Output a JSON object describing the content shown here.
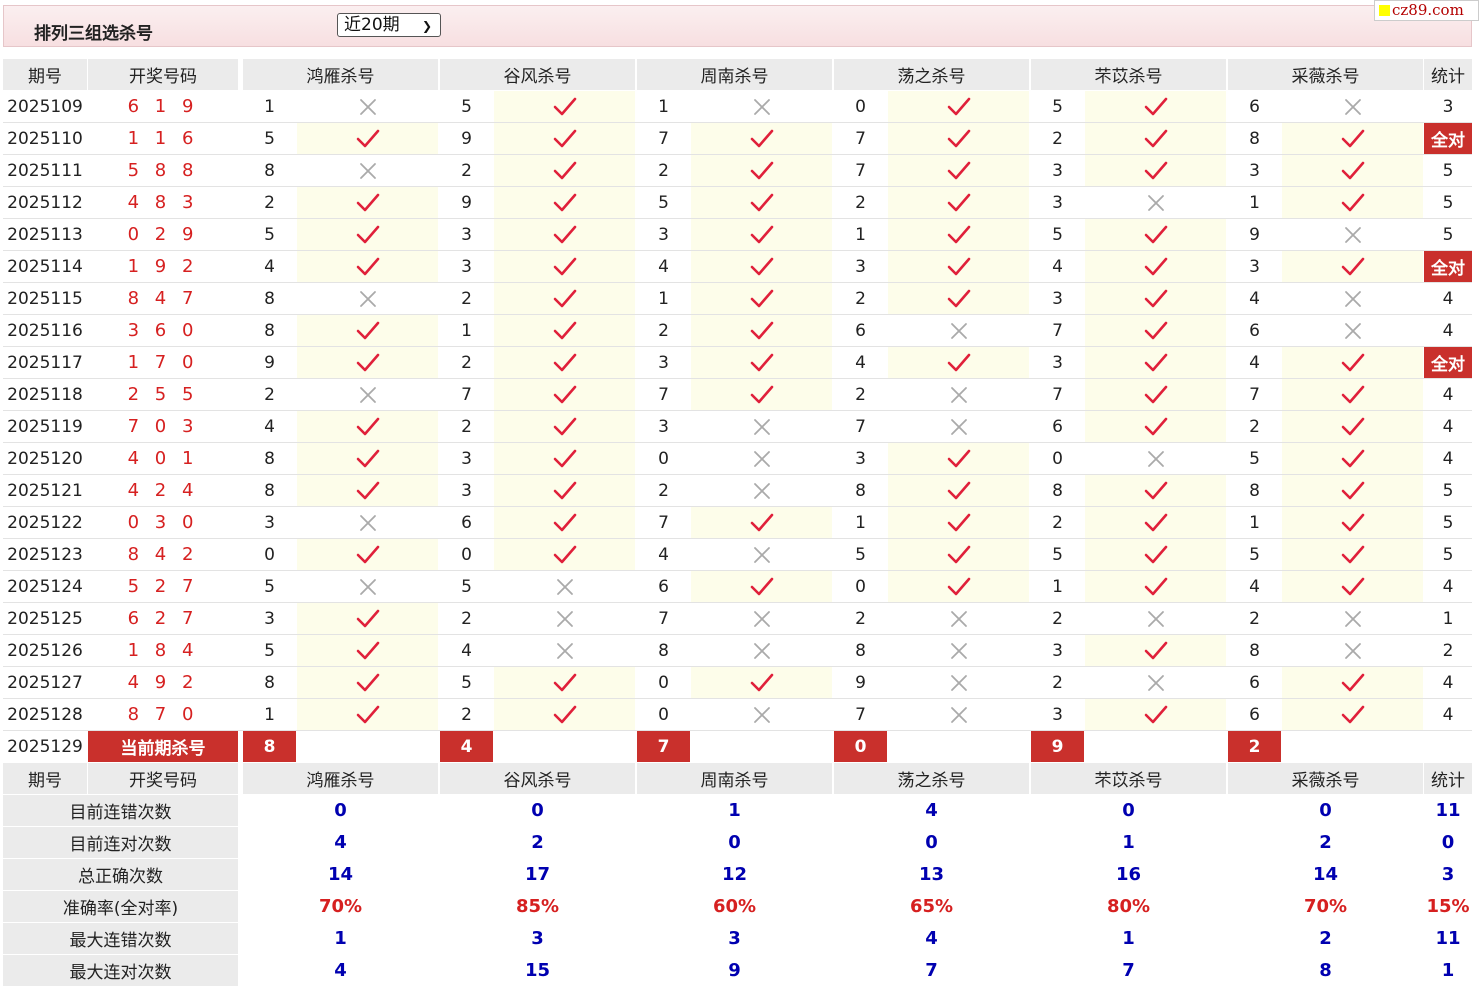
{
  "header": {
    "title": "排列三组选杀号",
    "period_select": "近20期",
    "logo": "cz89.com"
  },
  "columns": {
    "issue": "期号",
    "draw": "开奖号码",
    "experts": [
      "鸿雁杀号",
      "谷风杀号",
      "周南杀号",
      "荡之杀号",
      "芣苡杀号",
      "采薇杀号"
    ],
    "stat": "统计"
  },
  "marks": {
    "hit": "✓",
    "miss": "✗",
    "full": "全对"
  },
  "rows": [
    {
      "issue": "2025109",
      "draw": "6 1 9",
      "picks": [
        "1",
        "5",
        "1",
        "0",
        "5",
        "6"
      ],
      "hits": [
        0,
        1,
        0,
        1,
        1,
        0
      ],
      "stat": "3"
    },
    {
      "issue": "2025110",
      "draw": "1 1 6",
      "picks": [
        "5",
        "9",
        "7",
        "7",
        "2",
        "8"
      ],
      "hits": [
        1,
        1,
        1,
        1,
        1,
        1
      ],
      "stat": "全对"
    },
    {
      "issue": "2025111",
      "draw": "5 8 8",
      "picks": [
        "8",
        "2",
        "2",
        "7",
        "3",
        "3"
      ],
      "hits": [
        0,
        1,
        1,
        1,
        1,
        1
      ],
      "stat": "5"
    },
    {
      "issue": "2025112",
      "draw": "4 8 3",
      "picks": [
        "2",
        "9",
        "5",
        "2",
        "3",
        "1"
      ],
      "hits": [
        1,
        1,
        1,
        1,
        0,
        1
      ],
      "stat": "5"
    },
    {
      "issue": "2025113",
      "draw": "0 2 9",
      "picks": [
        "5",
        "3",
        "3",
        "1",
        "5",
        "9"
      ],
      "hits": [
        1,
        1,
        1,
        1,
        1,
        0
      ],
      "stat": "5"
    },
    {
      "issue": "2025114",
      "draw": "1 9 2",
      "picks": [
        "4",
        "3",
        "4",
        "3",
        "4",
        "3"
      ],
      "hits": [
        1,
        1,
        1,
        1,
        1,
        1
      ],
      "stat": "全对"
    },
    {
      "issue": "2025115",
      "draw": "8 4 7",
      "picks": [
        "8",
        "2",
        "1",
        "2",
        "3",
        "4"
      ],
      "hits": [
        0,
        1,
        1,
        1,
        1,
        0
      ],
      "stat": "4"
    },
    {
      "issue": "2025116",
      "draw": "3 6 0",
      "picks": [
        "8",
        "1",
        "2",
        "6",
        "7",
        "6"
      ],
      "hits": [
        1,
        1,
        1,
        0,
        1,
        0
      ],
      "stat": "4"
    },
    {
      "issue": "2025117",
      "draw": "1 7 0",
      "picks": [
        "9",
        "2",
        "3",
        "4",
        "3",
        "4"
      ],
      "hits": [
        1,
        1,
        1,
        1,
        1,
        1
      ],
      "stat": "全对"
    },
    {
      "issue": "2025118",
      "draw": "2 5 5",
      "picks": [
        "2",
        "7",
        "7",
        "2",
        "7",
        "7"
      ],
      "hits": [
        0,
        1,
        1,
        0,
        1,
        1
      ],
      "stat": "4"
    },
    {
      "issue": "2025119",
      "draw": "7 0 3",
      "picks": [
        "4",
        "2",
        "3",
        "7",
        "6",
        "2"
      ],
      "hits": [
        1,
        1,
        0,
        0,
        1,
        1
      ],
      "stat": "4"
    },
    {
      "issue": "2025120",
      "draw": "4 0 1",
      "picks": [
        "8",
        "3",
        "0",
        "3",
        "0",
        "5"
      ],
      "hits": [
        1,
        1,
        0,
        1,
        0,
        1
      ],
      "stat": "4"
    },
    {
      "issue": "2025121",
      "draw": "4 2 4",
      "picks": [
        "8",
        "3",
        "2",
        "8",
        "8",
        "8"
      ],
      "hits": [
        1,
        1,
        0,
        1,
        1,
        1
      ],
      "stat": "5"
    },
    {
      "issue": "2025122",
      "draw": "0 3 0",
      "picks": [
        "3",
        "6",
        "7",
        "1",
        "2",
        "1"
      ],
      "hits": [
        0,
        1,
        1,
        1,
        1,
        1
      ],
      "stat": "5"
    },
    {
      "issue": "2025123",
      "draw": "8 4 2",
      "picks": [
        "0",
        "0",
        "4",
        "5",
        "5",
        "5"
      ],
      "hits": [
        1,
        1,
        0,
        1,
        1,
        1
      ],
      "stat": "5"
    },
    {
      "issue": "2025124",
      "draw": "5 2 7",
      "picks": [
        "5",
        "5",
        "6",
        "0",
        "1",
        "4"
      ],
      "hits": [
        0,
        0,
        1,
        1,
        1,
        1
      ],
      "stat": "4"
    },
    {
      "issue": "2025125",
      "draw": "6 2 7",
      "picks": [
        "3",
        "2",
        "7",
        "2",
        "2",
        "2"
      ],
      "hits": [
        1,
        0,
        0,
        0,
        0,
        0
      ],
      "stat": "1"
    },
    {
      "issue": "2025126",
      "draw": "1 8 4",
      "picks": [
        "5",
        "4",
        "8",
        "8",
        "3",
        "8"
      ],
      "hits": [
        1,
        0,
        0,
        0,
        1,
        0
      ],
      "stat": "2"
    },
    {
      "issue": "2025127",
      "draw": "4 9 2",
      "picks": [
        "8",
        "5",
        "0",
        "9",
        "2",
        "6"
      ],
      "hits": [
        1,
        1,
        1,
        0,
        0,
        1
      ],
      "stat": "4"
    },
    {
      "issue": "2025128",
      "draw": "8 7 0",
      "picks": [
        "1",
        "2",
        "0",
        "7",
        "3",
        "6"
      ],
      "hits": [
        1,
        1,
        0,
        0,
        1,
        1
      ],
      "stat": "4"
    }
  ],
  "current": {
    "issue": "2025129",
    "label": "当前期杀号",
    "picks": [
      "8",
      "4",
      "7",
      "0",
      "9",
      "2"
    ]
  },
  "stats": [
    {
      "label": "目前连错次数",
      "values": [
        "0",
        "0",
        "1",
        "4",
        "0",
        "0"
      ],
      "stat": "11"
    },
    {
      "label": "目前连对次数",
      "values": [
        "4",
        "2",
        "0",
        "0",
        "1",
        "2"
      ],
      "stat": "0"
    },
    {
      "label": "总正确次数",
      "values": [
        "14",
        "17",
        "12",
        "13",
        "16",
        "14"
      ],
      "stat": "3"
    },
    {
      "label": "准确率(全对率)",
      "values": [
        "70%",
        "85%",
        "60%",
        "65%",
        "80%",
        "70%"
      ],
      "stat": "15%",
      "red": true
    },
    {
      "label": "最大连错次数",
      "values": [
        "1",
        "3",
        "3",
        "4",
        "1",
        "2"
      ],
      "stat": "11"
    },
    {
      "label": "最大连对次数",
      "values": [
        "4",
        "15",
        "9",
        "7",
        "7",
        "8"
      ],
      "stat": "1"
    }
  ],
  "colors": {
    "accent_red": "#c9302c",
    "draw_red": "#d62020",
    "check_red": "#e0203a",
    "cross_gray": "#aaaaaa",
    "stat_blue": "#0000b0",
    "hit_bg": "#fdfdea",
    "header_bg": "#ebebeb"
  }
}
